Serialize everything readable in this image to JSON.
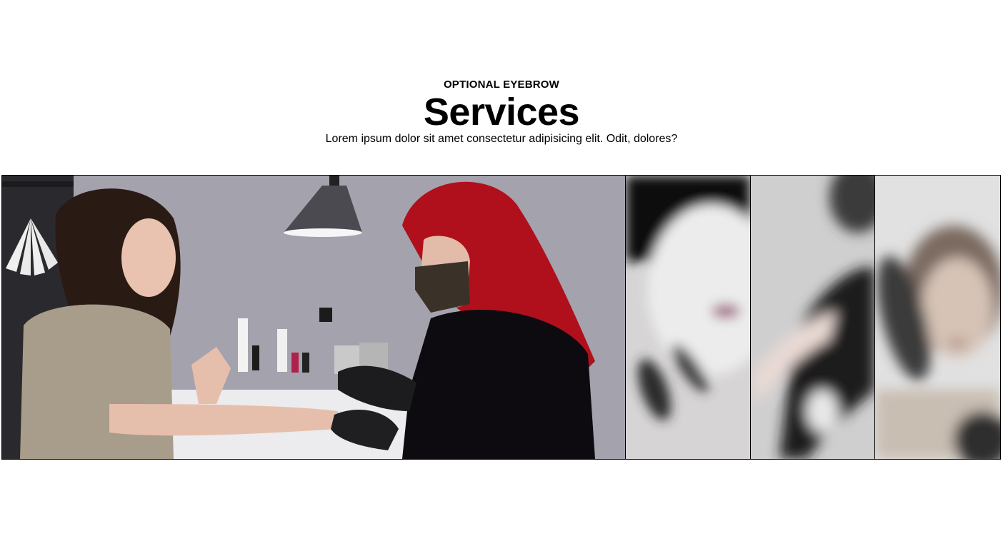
{
  "section": {
    "eyebrow": "OPTIONAL EYEBROW",
    "title": "Services",
    "subtitle": "Lorem ipsum dolor sit amet consectetur adipisicing elit. Odit, dolores?"
  },
  "gallery": {
    "panels": [
      {
        "id": "panel-1",
        "state": "expanded",
        "depicts": "manicure-session"
      },
      {
        "id": "panel-2",
        "state": "collapsed",
        "depicts": "blurred-nail-swatches"
      },
      {
        "id": "panel-3",
        "state": "collapsed",
        "depicts": "blurred-hair-styling"
      },
      {
        "id": "panel-4",
        "state": "collapsed",
        "depicts": "blurred-portrait"
      }
    ]
  },
  "colors": {
    "text": "#000000",
    "background": "#ffffff",
    "panel_border": "#000000",
    "hair_accent": "#b0101c"
  }
}
